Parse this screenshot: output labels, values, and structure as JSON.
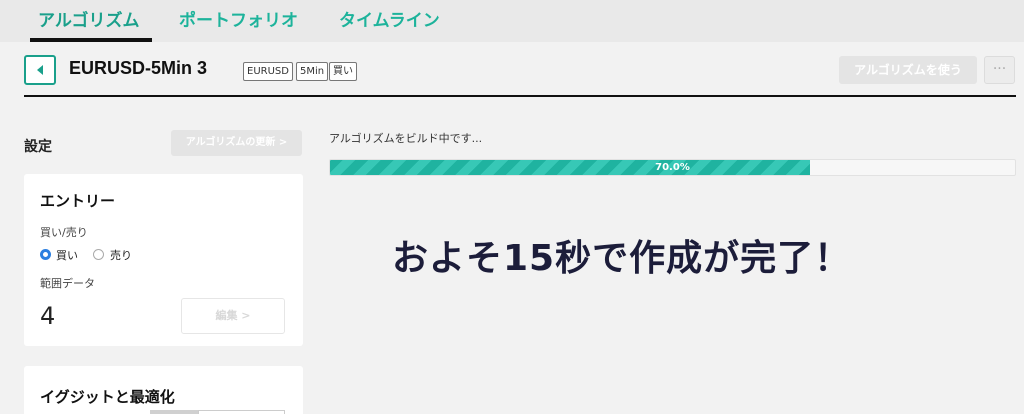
{
  "nav": {
    "tabs": [
      {
        "label": "アルゴリズム",
        "active": true
      },
      {
        "label": "ポートフォリオ",
        "active": false
      },
      {
        "label": "タイムライン",
        "active": false
      }
    ]
  },
  "header": {
    "back_icon": "chevron-left-icon",
    "title": "EURUSD-5Min 3",
    "tags": [
      "EURUSD",
      "5Min",
      "買い"
    ],
    "use_button": "アルゴリズムを使う",
    "more_button": "···"
  },
  "settings": {
    "label": "設定",
    "update_button": "アルゴリズムの更新 >",
    "entry": {
      "title": "エントリー",
      "side_label": "買い/売り",
      "options": [
        {
          "label": "買い",
          "selected": true
        },
        {
          "label": "売り",
          "selected": false
        }
      ],
      "range_label": "範囲データ",
      "range_value": "4",
      "edit_button": "編集 >"
    },
    "optimization": {
      "title": "イグジットと最適化"
    }
  },
  "build": {
    "status_text": "アルゴリズムをビルド中です...",
    "progress": 0.7,
    "progress_label": "70.0%",
    "headline": "およそ15秒で作成が完了！"
  },
  "colors": {
    "accent": "#1db39b",
    "progress_stripe_a": "#1fb3a0",
    "progress_stripe_b": "#37c8b6",
    "radio_selected": "#2b7fe0",
    "headline": "#1c1d3a"
  }
}
